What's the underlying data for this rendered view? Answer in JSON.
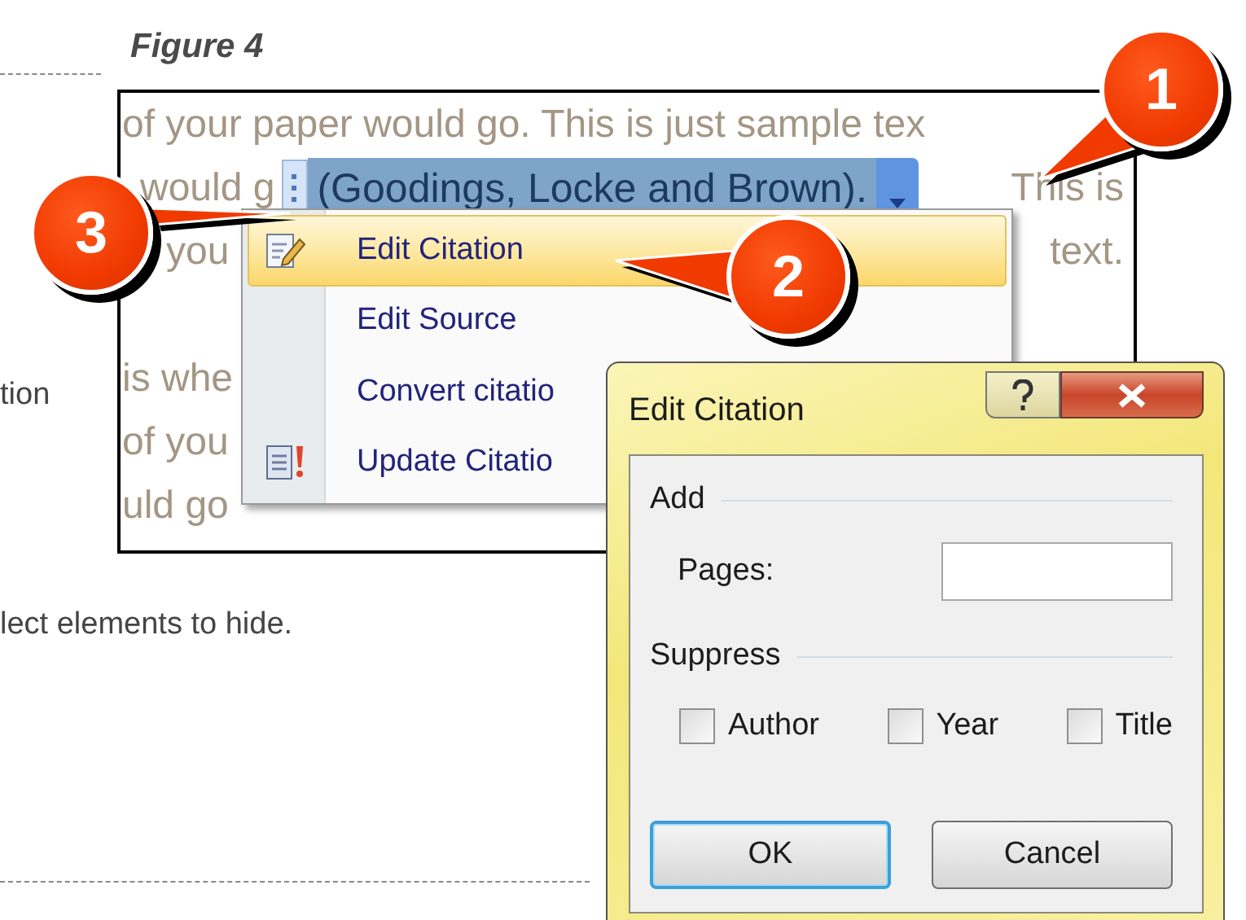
{
  "caption": "Figure 4",
  "side_texts": [
    "tion",
    "lect elements to hide."
  ],
  "document": {
    "lines": [
      {
        "left": "of your paper would go. This is just sample tex",
        "paragraph_start": false
      },
      {
        "left": "would g",
        "citation": {
          "text": "(Goodings, Locke and Brown).",
          "selected": true
        },
        "right": "This is",
        "paragraph_start": false
      },
      {
        "left": "you",
        "right": "text.",
        "paragraph_start": false
      },
      {
        "left": "is whe",
        "paragraph_start": true
      },
      {
        "left": "of you",
        "paragraph_start": false
      },
      {
        "left": "uld go",
        "paragraph_start": false
      }
    ]
  },
  "menu": {
    "items": [
      {
        "label": "Edit Citation",
        "kind": "edit",
        "selected": true
      },
      {
        "label": "Edit Source",
        "kind": "plain",
        "selected": false
      },
      {
        "label": "Convert citatio",
        "kind": "plain",
        "selected": false
      },
      {
        "label": "Update Citatio",
        "kind": "update",
        "selected": false
      }
    ]
  },
  "dialog": {
    "title": "Edit Citation",
    "add": {
      "heading": "Add",
      "pages_label": "Pages:"
    },
    "suppress": {
      "heading": "Suppress",
      "options": [
        {
          "label": "Author",
          "checked": false
        },
        {
          "label": "Year",
          "checked": false
        },
        {
          "label": "Title",
          "checked": false
        }
      ]
    },
    "buttons": [
      {
        "label": "OK",
        "default": true
      },
      {
        "label": "Cancel",
        "default": false
      }
    ]
  },
  "callouts": [
    "1",
    "2",
    "3"
  ]
}
